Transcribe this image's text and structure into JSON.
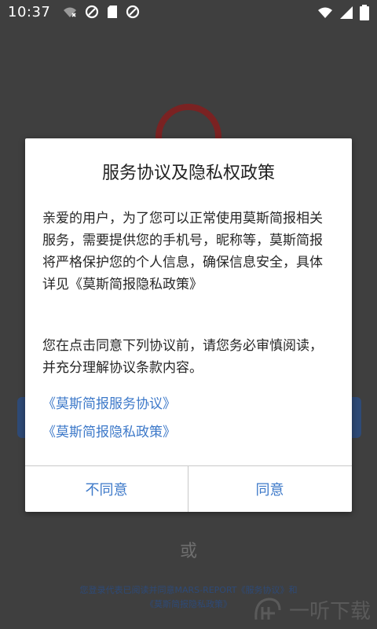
{
  "status_bar": {
    "time": "10:37",
    "icons_left": [
      "wifi-off-icon",
      "do-not-disturb-icon",
      "sd-card-icon",
      "do-not-disturb-icon"
    ],
    "icons_right": [
      "wifi-icon",
      "signal-icon",
      "battery-icon"
    ]
  },
  "background": {
    "or_text": "或",
    "footer_line1": "您登录代表已阅读并同意MARS-REPORT《服务协议》和",
    "footer_line2": "《莫斯简报隐私政策》",
    "watermark_text": "一听下载"
  },
  "dialog": {
    "title": "服务协议及隐私权政策",
    "paragraph1": "亲爱的用户，为了您可以正常使用莫斯简报相关服务，需要提供您的手机号，昵称等，莫斯简报将严格保护您的个人信息，确保信息安全，具体详见《莫斯简报隐私政策》",
    "paragraph2": "您在点击同意下列协议前，请您务必审慎阅读，并充分理解协议条款内容。",
    "link_service": "《莫斯简报服务协议》",
    "link_privacy": "《莫斯简报隐私政策》",
    "disagree_label": "不同意",
    "agree_label": "同意"
  },
  "colors": {
    "link": "#3d79c9",
    "overlay": "#3f3f3f",
    "brand_red": "#7a2222",
    "brand_blue": "#2e4a77"
  }
}
